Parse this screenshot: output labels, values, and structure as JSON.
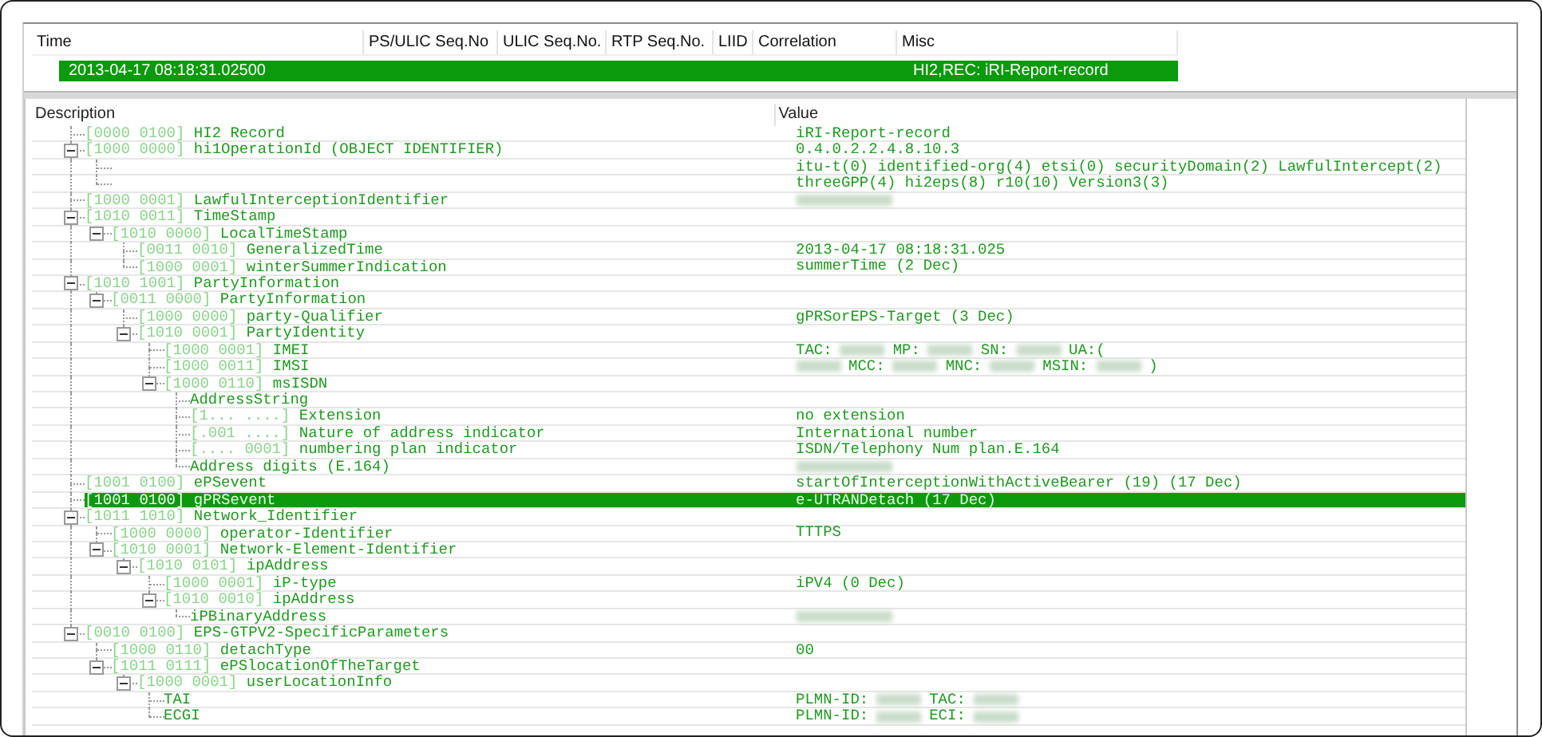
{
  "packet_list": {
    "columns": [
      "Time",
      "PS/ULIC Seq.No",
      "ULIC Seq.No.",
      "RTP Seq.No.",
      "LIID",
      "Correlation",
      "Misc"
    ],
    "rows": [
      {
        "selected": true,
        "cells": [
          "2013-04-17 08:18:31.02500",
          "",
          "",
          "",
          "",
          "",
          "HI2,REC: iRI-Report-record"
        ]
      }
    ]
  },
  "decode_tree": {
    "columns": [
      "Description",
      "Value"
    ],
    "nodes": [
      {
        "tag": "[0000 0100]",
        "name": "HI2 Record",
        "value": "iRI-Report-record",
        "selected": false
      },
      {
        "tag": "[1000 0000]",
        "name": "hi1OperationId (OBJECT IDENTIFIER)",
        "value": "0.4.0.2.2.4.8.10.3",
        "selected": false,
        "expanded": true,
        "children": [
          {
            "value": "itu-t(0) identified-org(4) etsi(0) securityDomain(2) LawfulIntercept(2)",
            "selected": false
          },
          {
            "value": "threeGPP(4) hi2eps(8) r10(10) Version3(3)",
            "selected": false
          }
        ]
      },
      {
        "tag": "[1000 0001]",
        "name": "LawfulInterceptionIdentifier",
        "value_parts": [
          {
            "kind": "blur"
          }
        ],
        "selected": false
      },
      {
        "tag": "[1010 0011]",
        "name": "TimeStamp",
        "selected": false,
        "expanded": true,
        "children": [
          {
            "tag": "[1010 0000]",
            "name": "LocalTimeStamp",
            "selected": false,
            "expanded": true,
            "children": [
              {
                "tag": "[0011 0010]",
                "name": "GeneralizedTime",
                "value": "2013-04-17 08:18:31.025",
                "selected": false
              },
              {
                "tag": "[1000 0001]",
                "name": "winterSummerIndication",
                "value": "summerTime (2 Dec)",
                "selected": false
              }
            ]
          }
        ]
      },
      {
        "tag": "[1010 1001]",
        "name": "PartyInformation",
        "selected": false,
        "expanded": true,
        "children": [
          {
            "tag": "[0011 0000]",
            "name": "PartyInformation",
            "selected": false,
            "expanded": true,
            "children": [
              {
                "tag": "[1000 0000]",
                "name": "party-Qualifier",
                "value": "gPRSorEPS-Target (3 Dec)",
                "selected": false
              },
              {
                "tag": "[1010 0001]",
                "name": "PartyIdentity",
                "selected": false,
                "expanded": true,
                "children": [
                  {
                    "tag": "[1000 0001]",
                    "name": "IMEI",
                    "selected": false,
                    "value_parts": [
                      {
                        "kind": "text",
                        "text": "TAC:"
                      },
                      {
                        "kind": "blur"
                      },
                      {
                        "kind": "text",
                        "text": "MP:"
                      },
                      {
                        "kind": "blur"
                      },
                      {
                        "kind": "text",
                        "text": "SN:"
                      },
                      {
                        "kind": "blur"
                      },
                      {
                        "kind": "text",
                        "text": "UA:("
                      }
                    ]
                  },
                  {
                    "tag": "[1000 0011]",
                    "name": "IMSI",
                    "selected": false,
                    "value_parts": [
                      {
                        "kind": "blur"
                      },
                      {
                        "kind": "text",
                        "text": "MCC:"
                      },
                      {
                        "kind": "blur"
                      },
                      {
                        "kind": "text",
                        "text": "MNC:"
                      },
                      {
                        "kind": "blur"
                      },
                      {
                        "kind": "text",
                        "text": "MSIN:"
                      },
                      {
                        "kind": "blur"
                      },
                      {
                        "kind": "text",
                        "text": ")"
                      }
                    ]
                  },
                  {
                    "tag": "[1000 0110]",
                    "name": "msISDN",
                    "selected": false,
                    "expanded": true,
                    "children": [
                      {
                        "name": "AddressString",
                        "selected": false
                      },
                      {
                        "tag": "[1... ....]",
                        "name": "Extension",
                        "value": "no extension",
                        "selected": false
                      },
                      {
                        "tag": "[.001 ....]",
                        "name": "Nature of address indicator",
                        "value": "International number",
                        "selected": false
                      },
                      {
                        "tag": "[.... 0001]",
                        "name": "numbering plan indicator",
                        "value": "ISDN/Telephony Num plan.E.164",
                        "selected": false
                      },
                      {
                        "name": "Address digits (E.164)",
                        "value_parts": [
                          {
                            "kind": "blur"
                          }
                        ],
                        "selected": false
                      }
                    ]
                  }
                ]
              }
            ]
          }
        ]
      },
      {
        "tag": "[1001 0100]",
        "name": "ePSevent",
        "value": "startOfInterceptionWithActiveBearer (19) (17 Dec)",
        "selected": false
      },
      {
        "tag": "[1001 0100]",
        "name": "gPRSevent",
        "value": "e-UTRANDetach (17 Dec)",
        "selected": true
      },
      {
        "tag": "[1011 1010]",
        "name": "Network_Identifier",
        "selected": false,
        "expanded": true,
        "children": [
          {
            "tag": "[1000 0000]",
            "name": "operator-Identifier",
            "value": "TTTPS",
            "selected": false
          },
          {
            "tag": "[1010 0001]",
            "name": "Network-Element-Identifier",
            "selected": false,
            "expanded": true,
            "children": [
              {
                "tag": "[1010 0101]",
                "name": "ipAddress",
                "selected": false,
                "expanded": true,
                "children": [
                  {
                    "tag": "[1000 0001]",
                    "name": "iP-type",
                    "value": "iPV4 (0 Dec)",
                    "selected": false
                  },
                  {
                    "tag": "[1010 0010]",
                    "name": "ipAddress",
                    "selected": false,
                    "expanded": true,
                    "children": [
                      {
                        "name": "iPBinaryAddress",
                        "value_parts": [
                          {
                            "kind": "blur"
                          }
                        ],
                        "selected": false
                      }
                    ]
                  }
                ]
              }
            ]
          }
        ]
      },
      {
        "tag": "[0010 0100]",
        "name": "EPS-GTPV2-SpecificParameters",
        "selected": false,
        "expanded": true,
        "children": [
          {
            "tag": "[1000 0110]",
            "name": "detachType",
            "value": "00",
            "selected": false
          },
          {
            "tag": "[1011 0111]",
            "name": "ePSlocationOfTheTarget",
            "selected": false,
            "expanded": true,
            "children": [
              {
                "tag": "[1000 0001]",
                "name": "userLocationInfo",
                "selected": false,
                "expanded": true,
                "children": [
                  {
                    "name": "TAI",
                    "selected": false,
                    "value_parts": [
                      {
                        "kind": "text",
                        "text": "PLMN-ID:"
                      },
                      {
                        "kind": "blur"
                      },
                      {
                        "kind": "text",
                        "text": "TAC:"
                      },
                      {
                        "kind": "blur"
                      }
                    ]
                  },
                  {
                    "name": "ECGI",
                    "selected": false,
                    "value_parts": [
                      {
                        "kind": "text",
                        "text": "PLMN-ID:"
                      },
                      {
                        "kind": "blur"
                      },
                      {
                        "kind": "text",
                        "text": "ECI:"
                      },
                      {
                        "kind": "blur"
                      }
                    ]
                  }
                ]
              }
            ]
          }
        ]
      }
    ]
  }
}
